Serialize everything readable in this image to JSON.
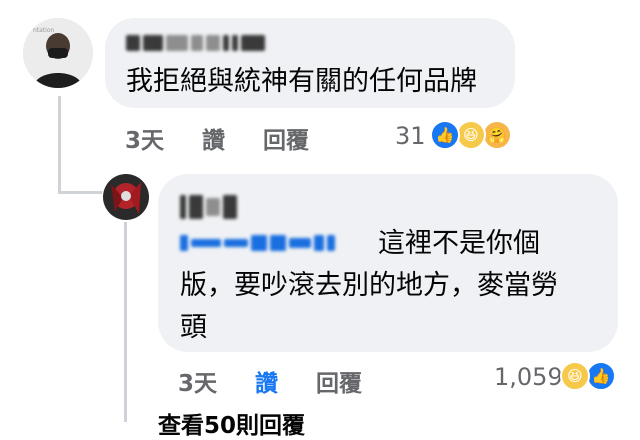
{
  "comments": [
    {
      "author_name": "",
      "text": "我拒絕與統神有關的任何品牌",
      "time": "3天",
      "like_label": "讚",
      "reply_label": "回覆",
      "reaction_count": "31",
      "reactions": [
        "like-icon",
        "haha-icon",
        "care-icon"
      ]
    },
    {
      "author_name": "",
      "text_line1": "這裡不是你個",
      "text_line2": "版，要吵滾去別的地方，麥當勞",
      "text_line3": "頭",
      "time": "3天",
      "like_label": "讚",
      "like_active": true,
      "reply_label": "回覆",
      "reaction_count": "1,059",
      "reactions": [
        "haha-icon",
        "like-icon"
      ]
    }
  ],
  "view_more_replies": "查看50則回覆",
  "colors": {
    "accent": "#1877f2",
    "bubble": "#eff1f4",
    "meta": "#65676b"
  }
}
